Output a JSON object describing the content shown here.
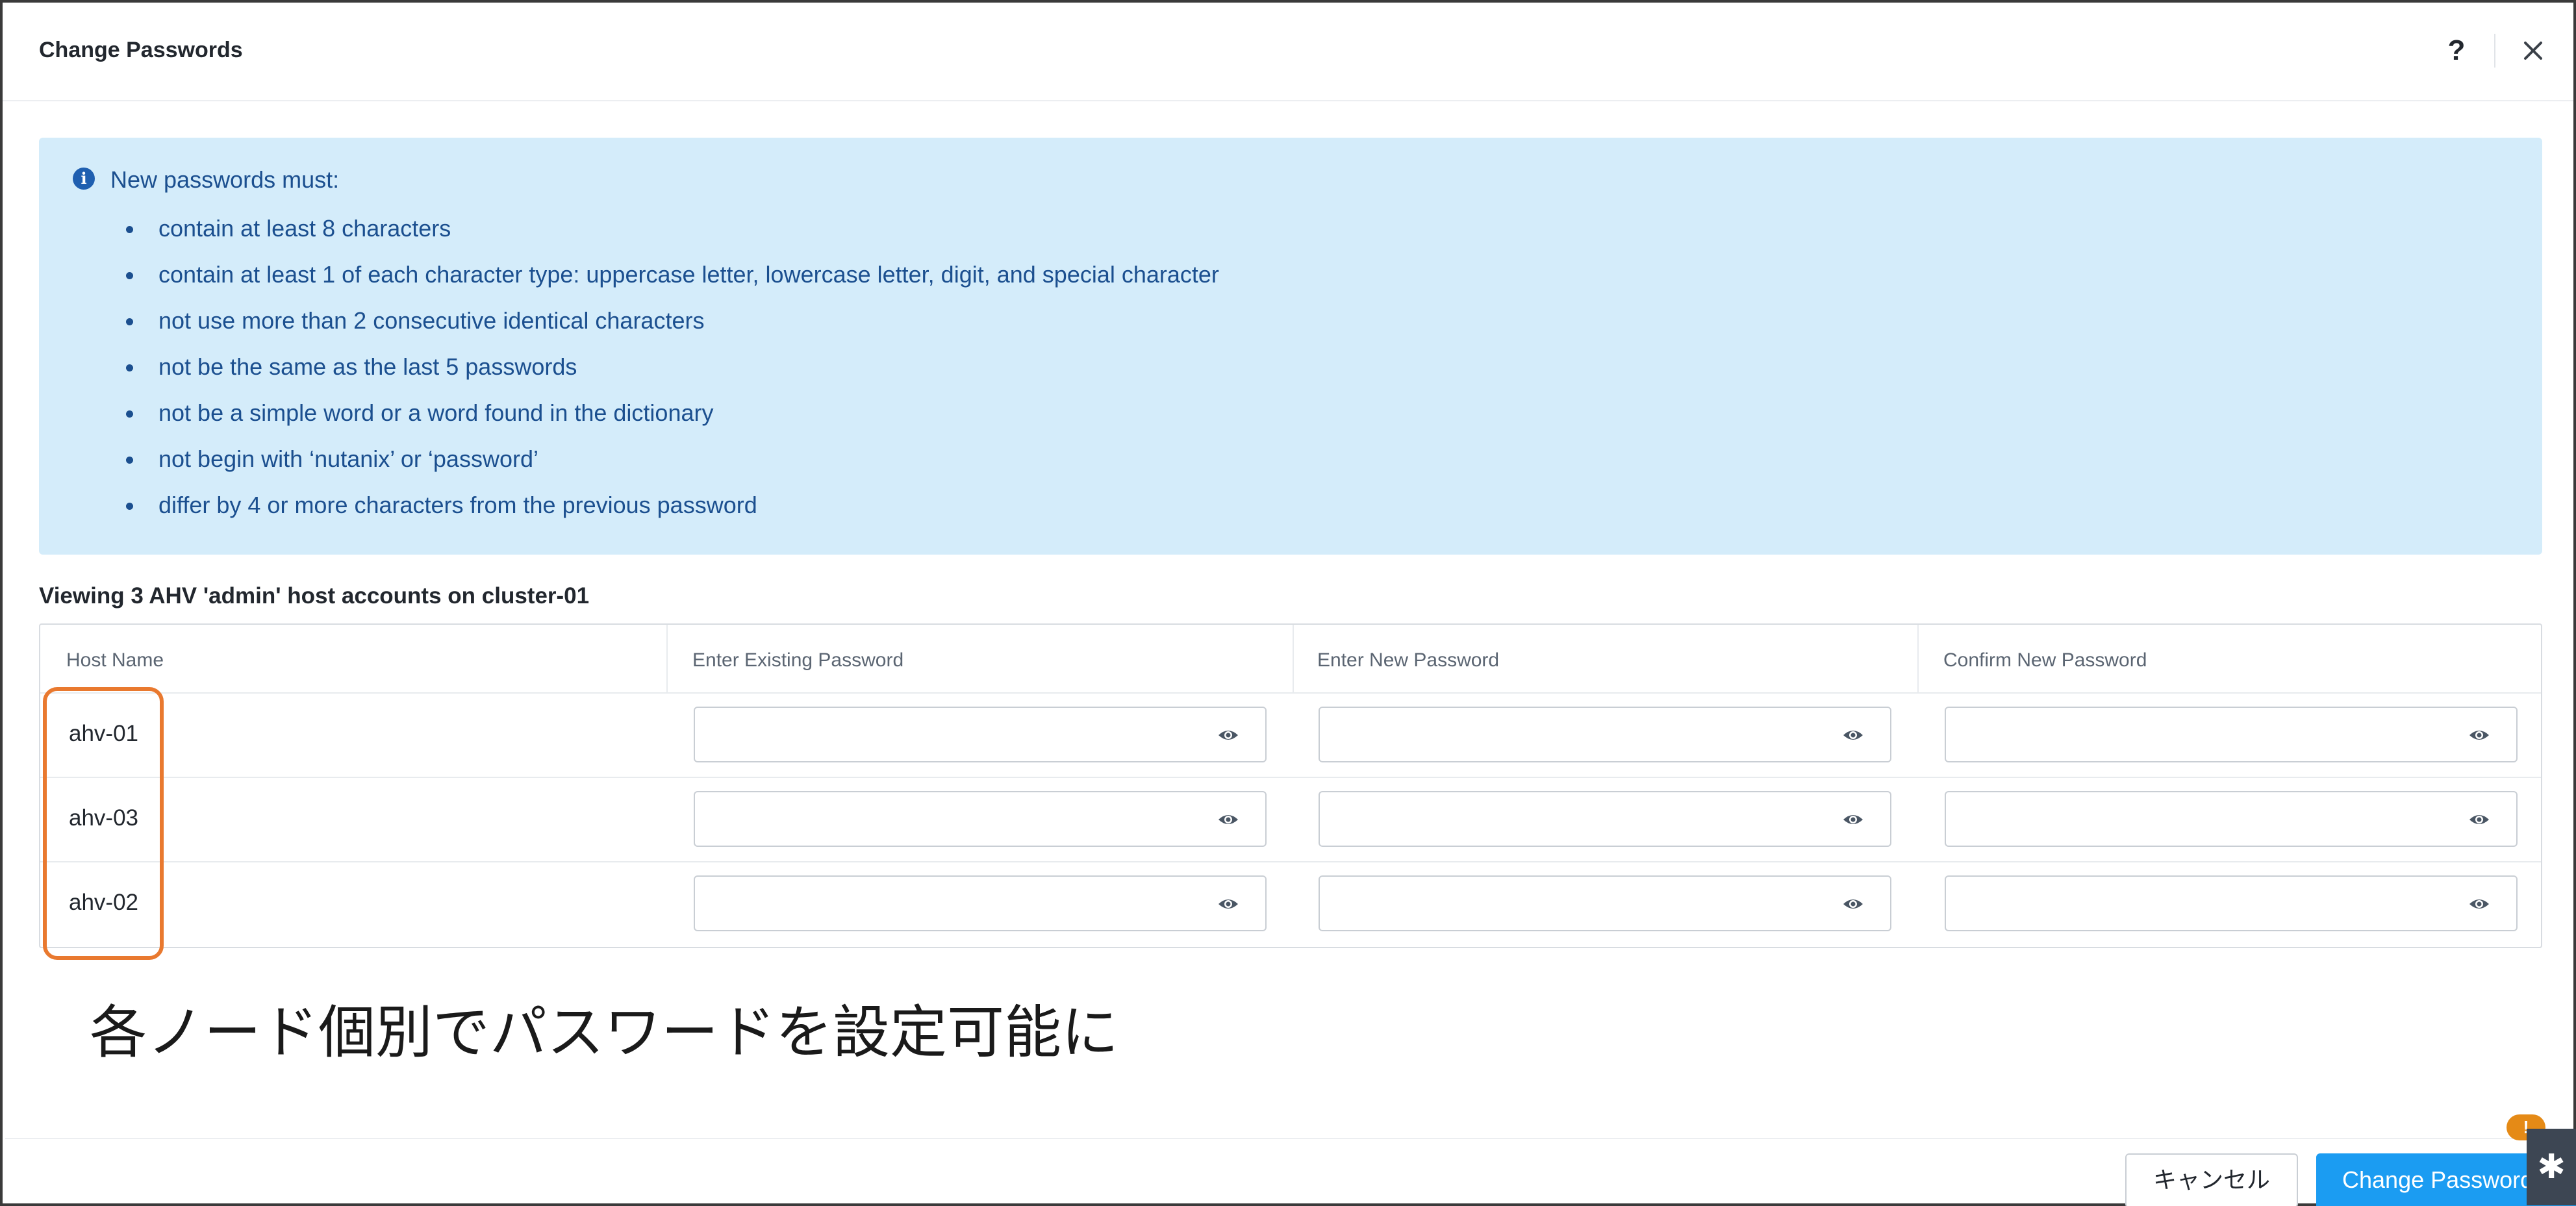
{
  "dialog": {
    "title": "Change Passwords",
    "help_label": "?",
    "close_label": "×"
  },
  "info": {
    "icon": "info-icon",
    "icon_glyph": "i",
    "title": "New passwords must:",
    "rules": [
      "contain at least 8 characters",
      "contain at least 1 of each character type: uppercase letter, lowercase letter, digit, and special character",
      "not use more than 2 consecutive identical characters",
      "not be the same as the last 5 passwords",
      "not be a simple word or a word found in the dictionary",
      "not begin with ‘nutanix’ or ‘password’",
      "differ by 4 or more characters from the previous password"
    ]
  },
  "table": {
    "caption": "Viewing 3 AHV 'admin' host accounts on cluster-01",
    "columns": [
      "Host Name",
      "Enter Existing Password",
      "Enter New Password",
      "Confirm New Password"
    ],
    "rows": [
      {
        "host": "ahv-01"
      },
      {
        "host": "ahv-03"
      },
      {
        "host": "ahv-02"
      }
    ],
    "field_icon": "eye-icon"
  },
  "annotation": "各ノード個別でパスワードを設定可能に",
  "footer": {
    "cancel_label": "キャンセル",
    "submit_label": "Change Passwords"
  },
  "widgets": {
    "badge_glyph": "!",
    "side_glyph": "✱"
  },
  "colors": {
    "accent": "#1b9cf2",
    "info_bg": "#d4ecfa",
    "info_text": "#1b4f8f",
    "highlight": "#e9792f"
  }
}
